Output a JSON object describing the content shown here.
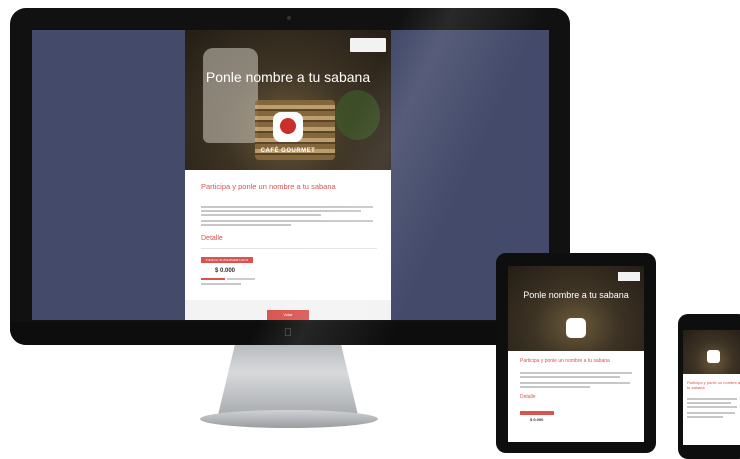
{
  "desktop": {
    "page": {
      "hero_title": "Ponle nombre a tu sabana",
      "hero_brand": "CAFÉ GOURMET",
      "subtitle": "Participa y ponle un nombre a tu sabana",
      "detail_heading": "Detalle",
      "price_tag": "TIENDA SUPERMERCADO",
      "price": "$ 0.000",
      "cta_label": "Votar"
    }
  },
  "tablet": {
    "page": {
      "hero_title": "Ponle nombre a tu sabana",
      "subtitle": "Participa y ponle un nombre a tu sabana",
      "detail_heading": "Detalle",
      "price": "$ 0.000"
    }
  },
  "phone": {
    "page": {
      "subtitle": "Participa y ponle un nombre a tu sabana"
    }
  },
  "colors": {
    "accent": "#d9534f",
    "screen_background": "#434a6a",
    "device_frame": "#111111"
  },
  "icons": {
    "apple_logo": "apple-icon",
    "hero_badge": "shield-icon"
  }
}
